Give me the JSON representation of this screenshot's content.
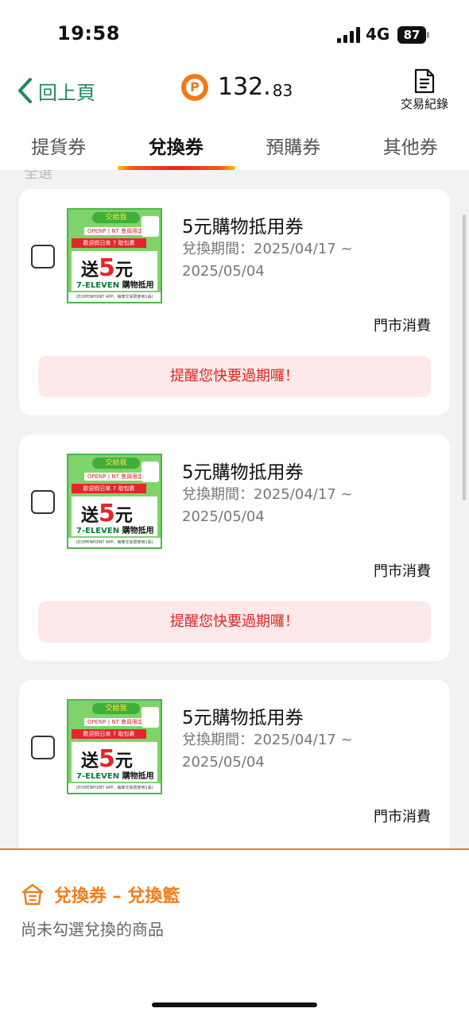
{
  "status": {
    "time": "19:58",
    "network": "4G",
    "battery": "87"
  },
  "header": {
    "back_label": "回上頁",
    "points_main": "132.",
    "points_decimal": "83",
    "transactions_label": "交易紀錄"
  },
  "tabs": [
    {
      "label": "提貨券",
      "active": false
    },
    {
      "label": "兌換券",
      "active": true
    },
    {
      "label": "預購券",
      "active": false
    },
    {
      "label": "其他券",
      "active": false
    }
  ],
  "partial_label": "全選",
  "coupons": [
    {
      "title": "5元購物抵用券",
      "period": "兌換期間：2025/04/17 ~ 2025/05/04",
      "store_label": "門市消費",
      "reminder": "提醒您快要過期囉！"
    },
    {
      "title": "5元購物抵用券",
      "period": "兌換期間：2025/04/17 ~ 2025/05/04",
      "store_label": "門市消費",
      "reminder": "提醒您快要過期囉！"
    },
    {
      "title": "5元購物抵用券",
      "period": "兌換期間：2025/04/17 ~ 2025/05/04",
      "store_label": "門市消費"
    }
  ],
  "thumb": {
    "banner": "交給我",
    "red_line": "歡迎假日來 7 取包裹",
    "top_line": "OPENP | NT 會員限定",
    "big_text": "送",
    "big_num": "5",
    "big_unit": "元",
    "brand": "7-ELEVEN",
    "brand_suffix": "購物抵用券",
    "footer": "(於OPENPOINT APP，每筆交易限使用1張)"
  },
  "basket": {
    "title": "兌換券 – 兌換籃",
    "empty_text": "尚未勾選兌換的商品"
  },
  "colors": {
    "accent": "#ef7d1a",
    "back_green": "#1e8a62",
    "reminder_red": "#e0241f",
    "reminder_bg": "#fde9ea"
  },
  "icons": [
    "back-chevron-icon",
    "point-p-icon",
    "document-icon",
    "basket-icon"
  ]
}
